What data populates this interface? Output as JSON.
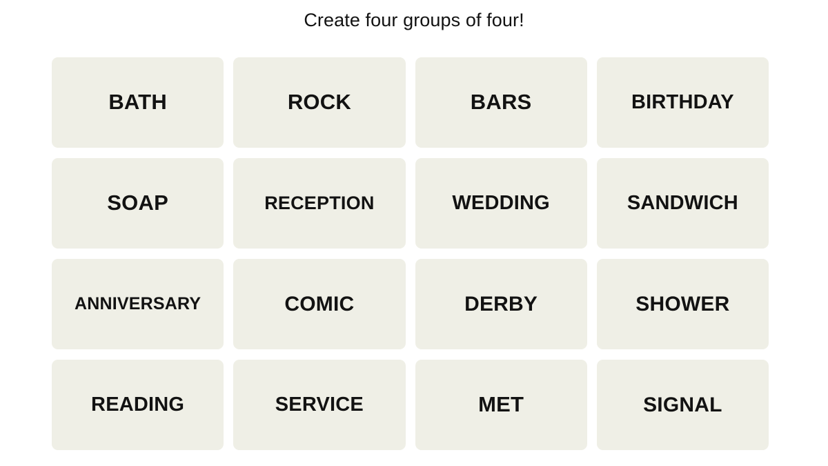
{
  "game": {
    "title": "Create four groups of four!",
    "colors": {
      "page_background": "#ffffff",
      "tile_background": "#efefe6",
      "text": "#121212"
    },
    "grid": {
      "columns": 4,
      "rows": 4,
      "tiles": [
        {
          "label": "BATH"
        },
        {
          "label": "ROCK"
        },
        {
          "label": "BARS"
        },
        {
          "label": "BIRTHDAY"
        },
        {
          "label": "SOAP"
        },
        {
          "label": "RECEPTION"
        },
        {
          "label": "WEDDING"
        },
        {
          "label": "SANDWICH"
        },
        {
          "label": "ANNIVERSARY"
        },
        {
          "label": "COMIC"
        },
        {
          "label": "DERBY"
        },
        {
          "label": "SHOWER"
        },
        {
          "label": "READING"
        },
        {
          "label": "SERVICE"
        },
        {
          "label": "MET"
        },
        {
          "label": "SIGNAL"
        }
      ]
    }
  }
}
